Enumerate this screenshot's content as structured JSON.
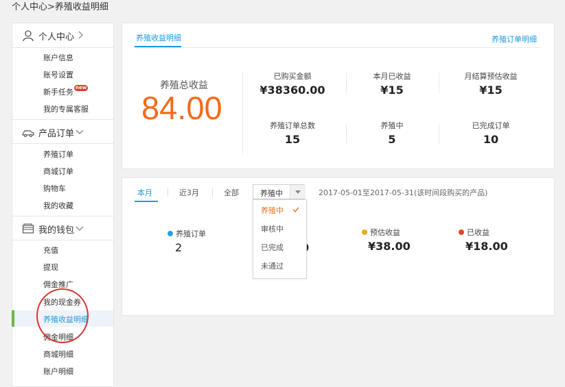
{
  "breadcrumb": "个人中心>养殖收益明细",
  "sidebar": {
    "groups": [
      {
        "label": "个人中心",
        "icon": "user-icon"
      },
      {
        "label": "产品订单",
        "icon": "truck-icon"
      },
      {
        "label": "我的钱包",
        "icon": "wallet-icon"
      }
    ],
    "items_personal": [
      "账户信息",
      "账号设置",
      "新手任务",
      "我的专属客服"
    ],
    "new_badge": "new",
    "items_orders": [
      "养殖订单",
      "商城订单",
      "购物车",
      "我的收藏"
    ],
    "items_wallet": [
      "充值",
      "提现",
      "佣金推广",
      "我的现金券",
      "养殖收益明细",
      "佣金明细",
      "商城明细",
      "账户明细"
    ],
    "active_item": "养殖收益明细"
  },
  "top_panel": {
    "tab": "养殖收益明细",
    "right_link": "养殖订单明细",
    "total_label": "养殖总收益",
    "total_value": "84.00",
    "stats": [
      {
        "label": "已购买金额",
        "value": "¥38360.00"
      },
      {
        "label": "本月已收益",
        "value": "¥15"
      },
      {
        "label": "月结算预估收益",
        "value": "¥15"
      },
      {
        "label": "养殖订单总数",
        "value": "15"
      },
      {
        "label": "养殖中",
        "value": "5"
      },
      {
        "label": "已完成订单",
        "value": "10"
      }
    ]
  },
  "bottom_panel": {
    "tabs": [
      "本月",
      "近3月",
      "全部"
    ],
    "active_tab": "本月",
    "select_value": "养殖中",
    "range_text": "2017-05-01至2017-05-31(该时间段购买的产品)",
    "summary": [
      {
        "label": "养殖订单",
        "value": "2",
        "color": "#2a9fe0"
      },
      {
        "label": "预估收益",
        "value": "¥38.00",
        "color": "#f5a623"
      },
      {
        "label": "已收益",
        "value": "¥18.00",
        "color": "#e04a1f"
      }
    ],
    "hidden_partial_value": "0"
  },
  "dropdown": {
    "options": [
      "养殖中",
      "审核中",
      "已完成",
      "未通过"
    ],
    "selected": "养殖中"
  },
  "colors": {
    "accent": "#1a9bde",
    "orange": "#f36b1c",
    "active_bar": "#68b943",
    "annotation": "#d9342f"
  }
}
